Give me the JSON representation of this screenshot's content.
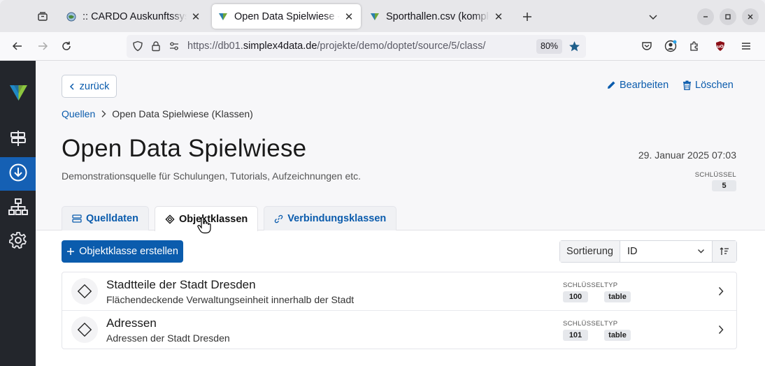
{
  "browser": {
    "tabs": [
      {
        "title": ":: CARDO Auskunftssystem ::",
        "active": false
      },
      {
        "title": "Open Data Spielwiese - Objektklassen",
        "active": true
      },
      {
        "title": "Sporthallen.csv (komplett)",
        "active": false
      }
    ],
    "url_prefix": "https://db01.",
    "url_domain": "simplex4data.de",
    "url_path": "/projekte/demo/doptet/source/5/class/",
    "zoom": "80%"
  },
  "sidebar": {
    "items": [
      {
        "icon": "signpost-icon",
        "active": false
      },
      {
        "icon": "download-icon",
        "active": true
      },
      {
        "icon": "hierarchy-icon",
        "active": false
      },
      {
        "icon": "gear-icon",
        "active": false
      }
    ]
  },
  "page": {
    "back_label": "zurück",
    "edit_label": "Bearbeiten",
    "delete_label": "Löschen",
    "breadcrumb_root": "Quellen",
    "breadcrumb_current": "Open Data Spielwiese (Klassen)",
    "title": "Open Data Spielwiese",
    "date": "29. Januar 2025 07:03",
    "description": "Demonstrationsquelle für Schulungen, Tutorials, Aufzeichnungen etc.",
    "key_label": "SCHLÜSSEL",
    "key_value": "5"
  },
  "tabs": {
    "quelldaten": "Quelldaten",
    "objektklassen": "Objektklassen",
    "verbindungsklassen": "Verbindungsklassen"
  },
  "toolbar": {
    "create_label": "Objektklasse erstellen",
    "sort_label": "Sortierung",
    "sort_value": "ID"
  },
  "list": {
    "key_label": "SCHLÜSSEL",
    "type_label": "TYP",
    "rows": [
      {
        "title": "Stadtteile der Stadt Dresden",
        "subtitle": "Flächendeckende Verwaltungseinheit innerhalb der Stadt",
        "key": "100",
        "type": "table"
      },
      {
        "title": "Adressen",
        "subtitle": "Adressen der Stadt Dresden",
        "key": "101",
        "type": "table"
      }
    ]
  },
  "colors": {
    "primary": "#0b5cad",
    "sidebar_bg": "#23262c",
    "sidebar_active": "#1560b4"
  }
}
